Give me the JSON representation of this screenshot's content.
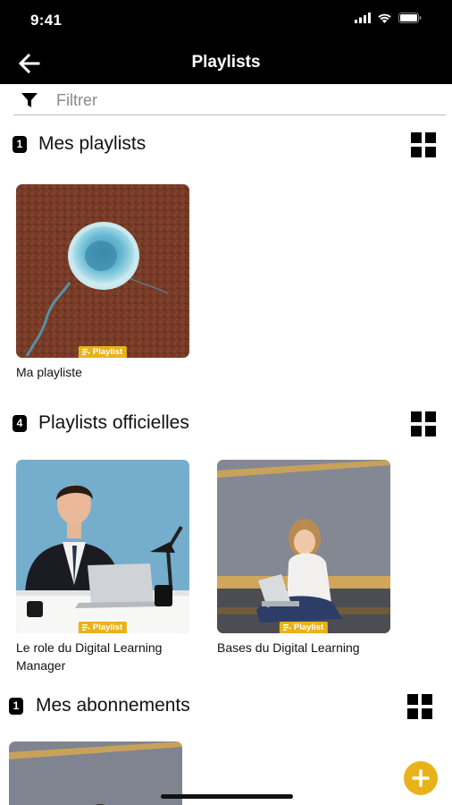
{
  "status_bar": {
    "time": "9:41"
  },
  "header": {
    "title": "Playlists"
  },
  "filter": {
    "placeholder": "Filtrer",
    "value": ""
  },
  "colors": {
    "accent": "#e8b21a",
    "header_bg": "#000000"
  },
  "sections": [
    {
      "count": "1",
      "title": "Mes playlists",
      "cards": [
        {
          "label": "Ma playliste",
          "tag": "Playlist"
        }
      ]
    },
    {
      "count": "4",
      "title": "Playlists officielles",
      "cards": [
        {
          "label": "Le role du Digital Learning Manager",
          "tag": "Playlist"
        },
        {
          "label": "Bases du Digital Learning",
          "tag": "Playlist"
        }
      ]
    },
    {
      "count": "1",
      "title": "Mes abonnements",
      "cards": []
    }
  ],
  "icons": {
    "back": "arrow-left-icon",
    "filter": "funnel-icon",
    "grid": "grid-view-icon",
    "fab": "plus-icon",
    "tag": "playlist-icon"
  },
  "fab": {
    "label": "+"
  }
}
